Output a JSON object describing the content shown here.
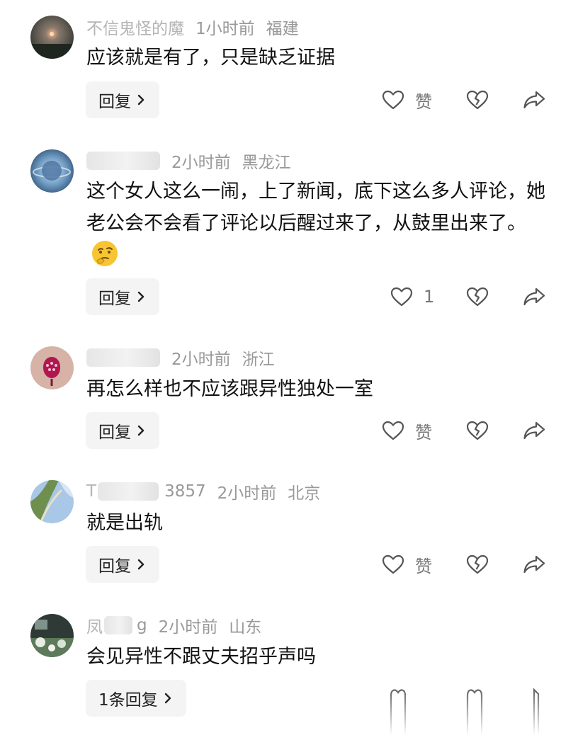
{
  "comments": [
    {
      "name": "不信鬼怪的魔",
      "time": "1小时前",
      "location": "福建",
      "text": "应该就是有了，只是缺乏证据",
      "like_label": "赞",
      "reply_label": "回复"
    },
    {
      "name": "",
      "time": "2小时前",
      "location": "黑龙江",
      "text": "这个女人这么一闹，上了新闻，底下这么多人评论，她老公会不会看了评论以后醒过来了，从鼓里出来了。",
      "like_label": "1",
      "reply_label": "回复",
      "emoji": "thinking-face-emoji"
    },
    {
      "name": "",
      "time": "2小时前",
      "location": "浙江",
      "text": "再怎么样也不应该跟异性独处一室",
      "like_label": "赞",
      "reply_label": "回复"
    },
    {
      "name": "T",
      "name_suffix": "3857",
      "time": "2小时前",
      "location": "北京",
      "text": "就是出轨",
      "like_label": "赞",
      "reply_label": "回复"
    },
    {
      "name": "凤",
      "name_suffix": "g",
      "time": "2小时前",
      "location": "山东",
      "text": "会见异性不跟丈夫招乎声吗",
      "reply_label": "1条回复"
    }
  ],
  "icons": {
    "like": "heart-outline-icon",
    "dislike": "broken-heart-icon",
    "share": "share-arrow-icon",
    "chevron": "chevron-right-icon"
  },
  "colors": {
    "meta_text": "#999999",
    "body_text": "#111111",
    "button_bg": "#f4f4f4",
    "icon": "#555555"
  }
}
